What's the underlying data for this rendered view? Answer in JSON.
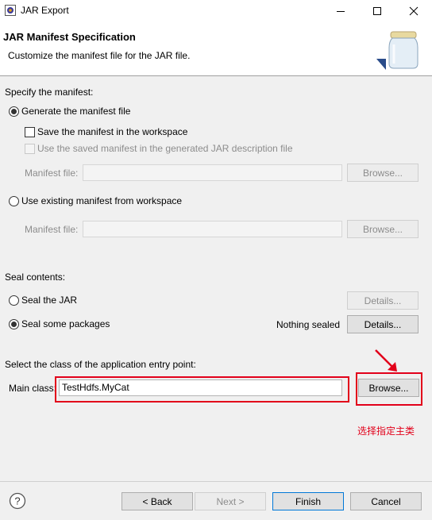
{
  "window": {
    "title": "JAR Export"
  },
  "banner": {
    "title": "JAR Manifest Specification",
    "subtitle": "Customize the manifest file for the JAR file."
  },
  "manifest": {
    "section_label": "Specify the manifest:",
    "generate_label": "Generate the manifest file",
    "save_label": "Save the manifest in the workspace",
    "use_saved_label": "Use the saved manifest in the generated JAR description file",
    "manifest_file_label": "Manifest file:",
    "browse_label": "Browse...",
    "use_existing_label": "Use existing manifest from workspace",
    "existing_file_label": "Manifest file:",
    "browse2_label": "Browse..."
  },
  "seal": {
    "section_label": "Seal contents:",
    "seal_jar_label": "Seal the JAR",
    "details_label": "Details...",
    "seal_packages_label": "Seal some packages",
    "nothing_sealed": "Nothing sealed",
    "details2_label": "Details..."
  },
  "entry": {
    "section_label": "Select the class of the application entry point:",
    "main_class_label": "Main class:",
    "main_class_value": "TestHdfs.MyCat",
    "browse_label": "Browse..."
  },
  "annotation": {
    "text": "选择指定主类",
    "color": "#e2001a"
  },
  "footer": {
    "back_label": "< Back",
    "next_label": "Next >",
    "finish_label": "Finish",
    "cancel_label": "Cancel"
  }
}
